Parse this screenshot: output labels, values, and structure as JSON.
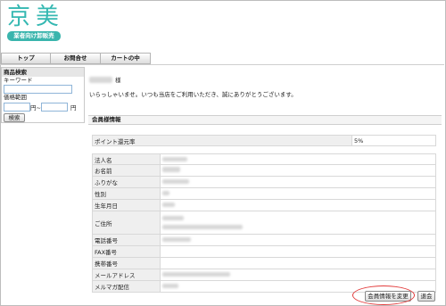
{
  "header": {
    "logo_title": "京美",
    "logo_subtitle": "業者向け卸販売"
  },
  "nav": {
    "tabs": [
      "トップ",
      "お問合せ",
      "カートの中"
    ]
  },
  "sidebar": {
    "title": "商品検索",
    "keyword_label": "キーワード",
    "keyword_value": "",
    "price_label": "価格範囲",
    "price_from_value": "",
    "price_to_value": "",
    "price_separator": "円~",
    "price_suffix": "円",
    "search_button": "検索"
  },
  "greeting": {
    "honorific": "様",
    "message": "いらっしゃいませ。いつも当店をご利用いただき、誠にありがとうございます。"
  },
  "member_info": {
    "section_title": "会員様情報",
    "point_label": "ポイント還元率",
    "point_value": "5%",
    "fields": [
      "法人名",
      "お名前",
      "ふりがな",
      "性別",
      "生年月日",
      "ご住所",
      "電話番号",
      "FAX番号",
      "携帯番号",
      "メールアドレス",
      "メルマガ配信"
    ]
  },
  "actions": {
    "edit_button": "会員情報を変更",
    "withdraw_button": "退会",
    "highlight_color": "#e23b3b"
  },
  "colors": {
    "brand": "#35b8b2"
  }
}
